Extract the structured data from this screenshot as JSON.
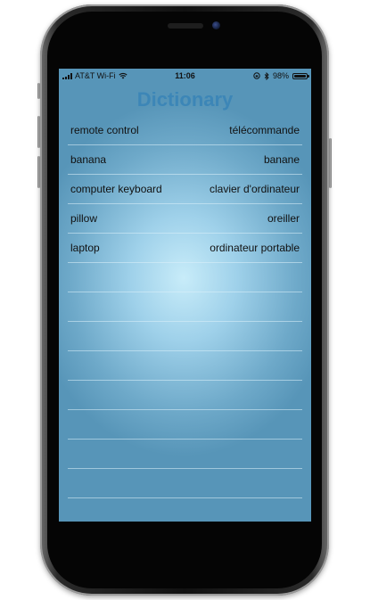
{
  "status_bar": {
    "carrier": "AT&T Wi-Fi",
    "time": "11:06",
    "battery_percent": "98%",
    "battery_level": 0.98,
    "icons": [
      "signal-bars-icon",
      "wifi-icon",
      "orientation-lock-icon",
      "bluetooth-icon",
      "battery-icon"
    ]
  },
  "app": {
    "title": "Dictionary"
  },
  "entries": [
    {
      "english": "remote control",
      "french": "télécommande"
    },
    {
      "english": "banana",
      "french": "banane"
    },
    {
      "english": "computer keyboard",
      "french": "clavier d'ordinateur"
    },
    {
      "english": "pillow",
      "french": "oreiller"
    },
    {
      "english": "laptop",
      "french": "ordinateur portable"
    },
    {
      "english": "",
      "french": ""
    },
    {
      "english": "",
      "french": ""
    },
    {
      "english": "",
      "french": ""
    },
    {
      "english": "",
      "french": ""
    },
    {
      "english": "",
      "french": ""
    },
    {
      "english": "",
      "french": ""
    },
    {
      "english": "",
      "french": ""
    },
    {
      "english": "",
      "french": ""
    },
    {
      "english": "",
      "french": ""
    }
  ],
  "colors": {
    "title": "#3c86b7",
    "background_center": "#c8ecf9",
    "background_edge": "#5795b8",
    "device_frame": "#111111"
  }
}
